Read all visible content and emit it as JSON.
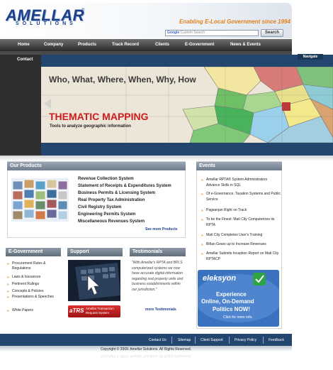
{
  "header": {
    "logo_text": "AMELLAR",
    "logo_sub": "SOLUTIONS",
    "logo_reg": "®",
    "tagline": "Enabling E-Local Government since 1994",
    "search_placeholder": "Custom Search",
    "search_brand": "Google",
    "search_button": "Search"
  },
  "nav": {
    "items": [
      "Home",
      "Company",
      "Products",
      "Track Record",
      "Clients",
      "E-Government",
      "News & Events"
    ],
    "contact": "Contact",
    "navigate": "Navigate"
  },
  "hero": {
    "question": "Who, What, Where, When, Why, How",
    "title": "THEMATIC MAPPING",
    "subtitle": "Tools to analyze geographic information"
  },
  "products": {
    "heading": "Our Products",
    "items": [
      "Revenue Collection System",
      "Statement of Receipts & Expenditures System",
      "Business Permits & Licensing System",
      "Real Property Tax Administration",
      "Civil Registry System",
      "Engineering Permits System",
      "Miscellaneous Revenues System"
    ],
    "see_more": "See more Products"
  },
  "events": {
    "heading": "Events",
    "items": [
      "Amellar RPTA® System Administrators Advance Skills in SQL",
      "Of e-Governance, Taxation Systems and Public Service",
      "Pagsanjan Right on Track",
      "To be the Finest: Mati City Computerizes its RPTA",
      "Mati City Completes User's Training",
      "Biñan Gears up to Increase Revenues",
      "Amellar Submits Inception Report on Mati City RPTACP"
    ],
    "ad": {
      "brand": "eleksyon",
      "line1": "Experience",
      "line2": "Online, On-Demand",
      "line3": "Politics NOW!",
      "cta": "Click for more info."
    }
  },
  "egov": {
    "heading": "E-Government",
    "items": [
      "Procurement Rules & Regulations",
      "Laws & Issuances",
      "Pertinent Rulings",
      "Concepts & Policies",
      "Presentations & Speeches",
      "White Papers"
    ]
  },
  "support": {
    "heading": "Support",
    "atrs_logo": "aTRS",
    "atrs_text": "Amellar Transaction Request System"
  },
  "testimonials": {
    "heading": "Testimonials",
    "quote": "\"With Amellar's RPTA and BPLS computerized systems we now have accurate digital information regarding real property units and business establishments within our jurisdiction.\"",
    "more": "more Testimonials"
  },
  "footer": {
    "links": [
      "Contact Us",
      "Sitemap",
      "Client Support",
      "Privacy Policy",
      "Feedback"
    ],
    "copyright": "Copyright © 2009. Amellar Solutions. All Rights Reserved."
  },
  "colors": {
    "brand_blue": "#1c3f8a",
    "accent_orange": "#e0811a",
    "hero_red": "#cc1c1c",
    "footer_blue": "#23466e"
  }
}
